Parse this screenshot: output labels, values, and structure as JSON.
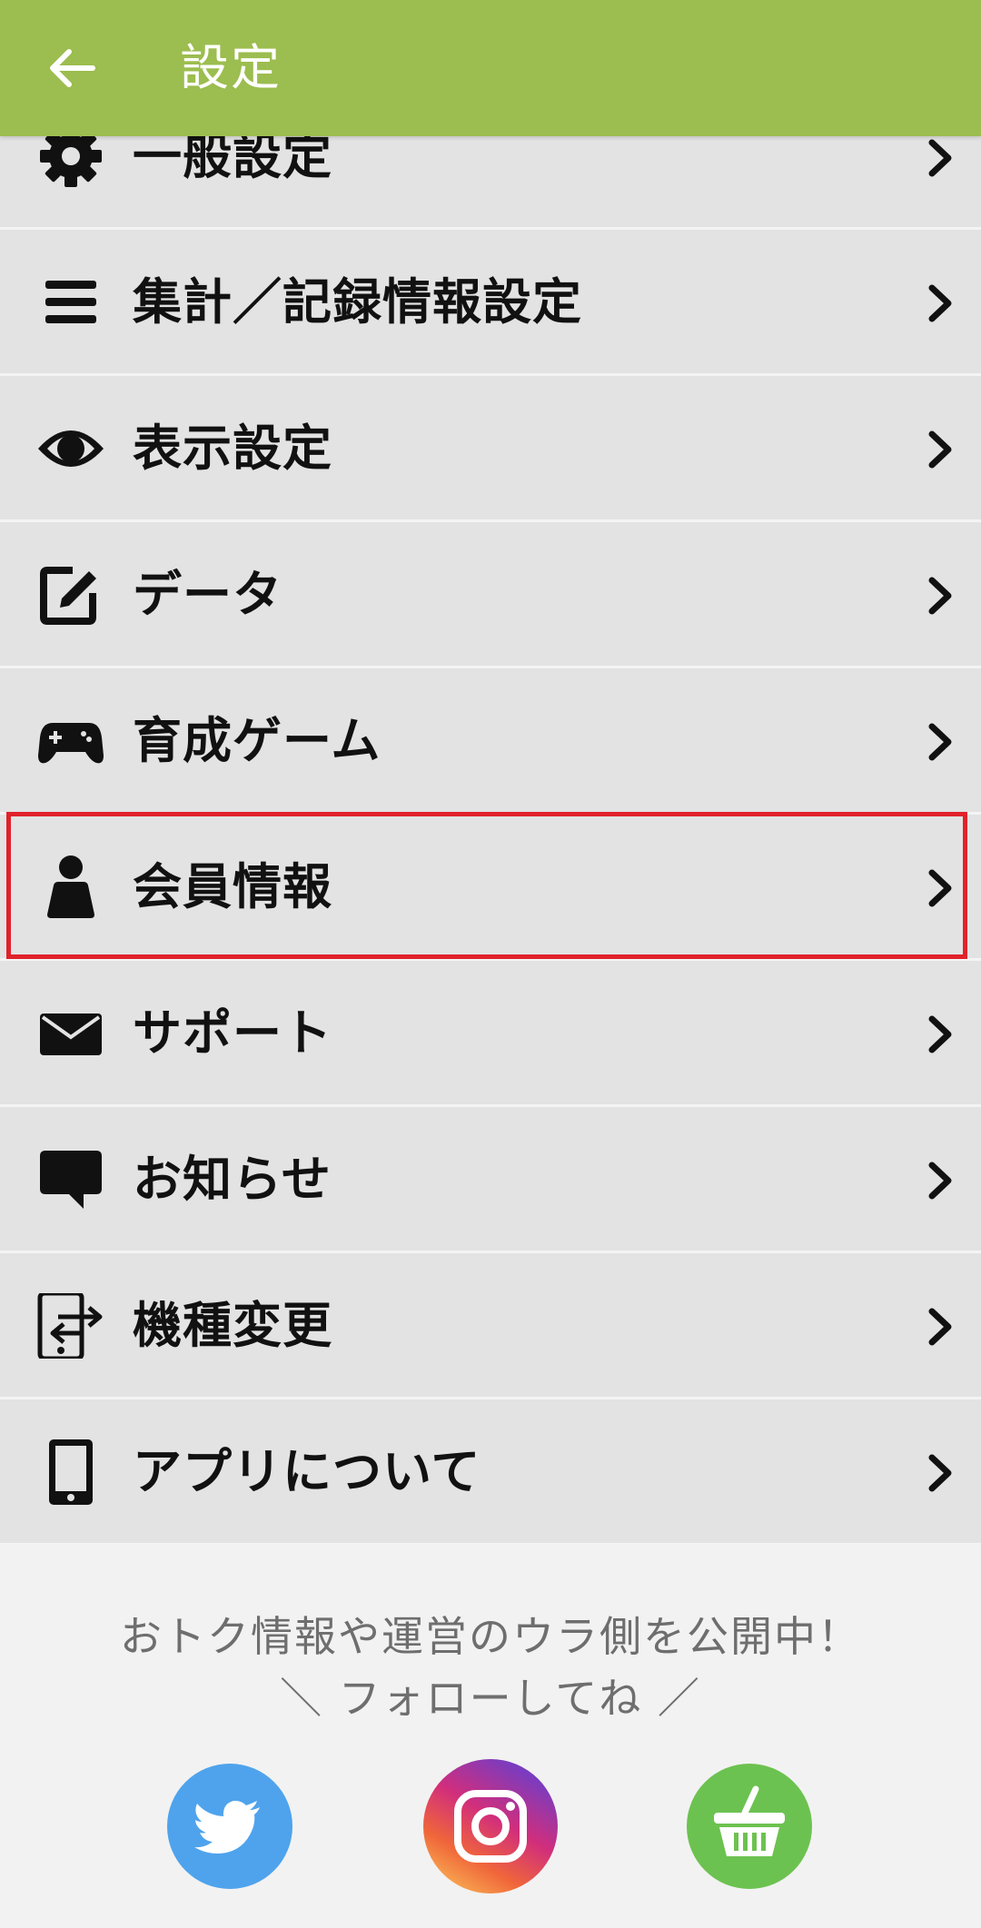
{
  "header": {
    "title": "設定",
    "back_icon": "back-arrow-icon",
    "bg_color": "#9cbd4f"
  },
  "menu": {
    "items": [
      {
        "label": "一般設定",
        "icon": "gear-icon"
      },
      {
        "label": "集計／記録情報設定",
        "icon": "list-icon"
      },
      {
        "label": "表示設定",
        "icon": "eye-icon"
      },
      {
        "label": "データ",
        "icon": "edit-icon"
      },
      {
        "label": "育成ゲーム",
        "icon": "gamepad-icon"
      },
      {
        "label": "会員情報",
        "icon": "person-icon",
        "highlighted": true
      },
      {
        "label": "サポート",
        "icon": "mail-icon"
      },
      {
        "label": "お知らせ",
        "icon": "chat-bubble-icon"
      },
      {
        "label": "機種変更",
        "icon": "phone-transfer-icon"
      },
      {
        "label": "アプリについて",
        "icon": "smartphone-icon"
      }
    ]
  },
  "promo": {
    "line1": "おトク情報や運営のウラ側を公開中！",
    "line2": "＼ フォローしてね ／",
    "social": [
      {
        "icon": "twitter-icon",
        "color": "#4fa3ec"
      },
      {
        "icon": "instagram-icon",
        "color": "#c13584"
      },
      {
        "icon": "shopping-basket-icon",
        "color": "#6cc250"
      }
    ]
  },
  "highlight_color": "#e0222b"
}
